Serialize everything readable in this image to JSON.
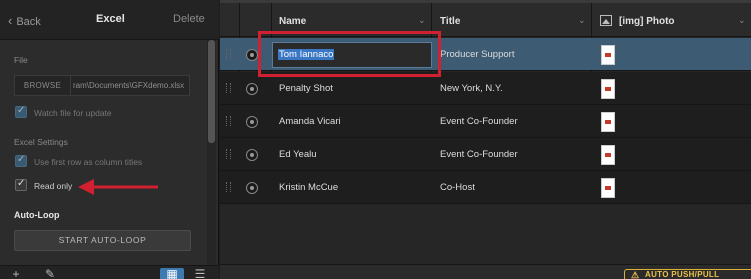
{
  "left_panel": {
    "back_label": "Back",
    "title": "Excel",
    "delete_label": "Delete",
    "file_label": "File",
    "browse_label": "BROWSE",
    "file_path": "ram\\Documents\\GFXdemo.xlsx",
    "watch_label": "Watch file for update",
    "watch_checked": true,
    "excel_settings_label": "Excel Settings",
    "first_row_label": "Use first row as column titles",
    "first_row_checked": true,
    "read_only_label": "Read only",
    "read_only_checked": true,
    "autoloop_title": "Auto-Loop",
    "autoloop_button": "START AUTO-LOOP",
    "footer": {
      "add_icon": "+",
      "edit_icon": "✎"
    }
  },
  "table": {
    "headers": {
      "name": "Name",
      "title": "Title",
      "photo": "[img] Photo"
    },
    "rows": [
      {
        "name": "Tom Iannaco",
        "title": "Producer Support",
        "selected": true
      },
      {
        "name": "Penalty Shot",
        "title": "New York, N.Y.",
        "selected": false
      },
      {
        "name": "Amanda Vicari",
        "title": "Event Co-Founder",
        "selected": false
      },
      {
        "name": "Ed Yealu",
        "title": "Event Co-Founder",
        "selected": false
      },
      {
        "name": "Kristin McCue",
        "title": "Co-Host",
        "selected": false
      }
    ],
    "auto_push_label": "AUTO PUSH/PULL"
  },
  "colors": {
    "accent": "#3d7ab2",
    "selected_row": "#3d5b73",
    "annotation": "#d1202f",
    "warning": "#e8c24a"
  }
}
